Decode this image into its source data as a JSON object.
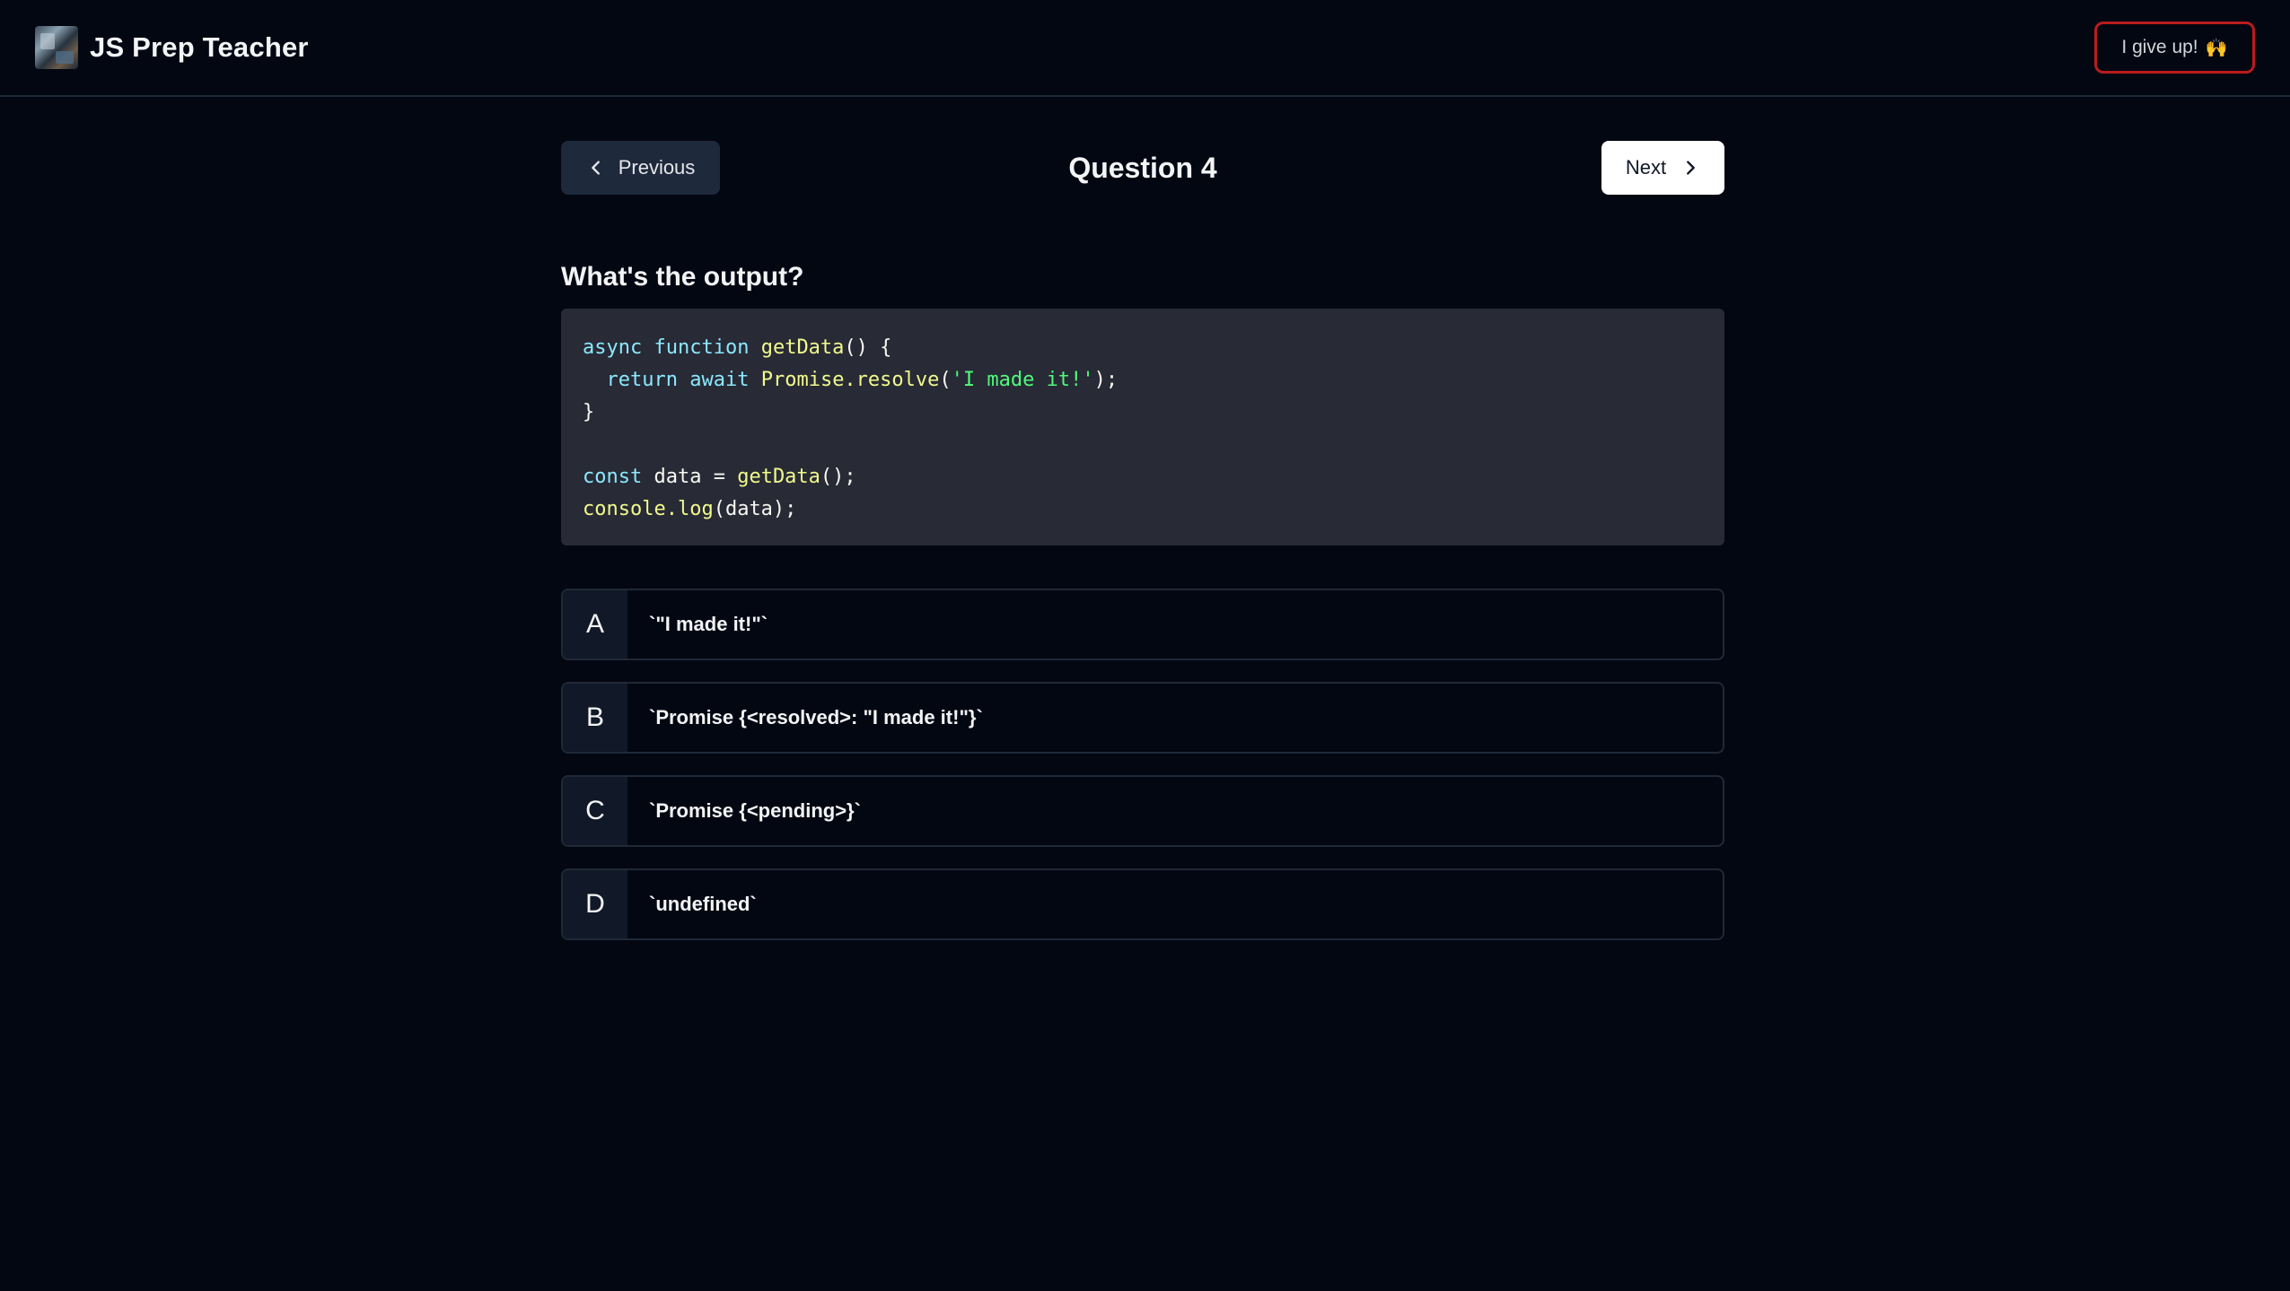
{
  "header": {
    "app_title": "JS Prep Teacher",
    "give_up_label": "I give up!",
    "give_up_emoji": "🙌"
  },
  "navigation": {
    "previous_label": "Previous",
    "next_label": "Next",
    "question_number": "Question 4"
  },
  "question": {
    "prompt": "What's the output?",
    "code": {
      "l1_kw1": "async",
      "l1_kw2": "function",
      "l1_fn": "getData",
      "l1_rest": "() {",
      "l2_kw1": "return",
      "l2_kw2": "await",
      "l2_fn": "Promise.resolve",
      "l2_open": "(",
      "l2_str": "'I made it!'",
      "l2_close": ");",
      "l3": "}",
      "l5_kw": "const",
      "l5_mid": " data = ",
      "l5_fn": "getData",
      "l5_end": "();",
      "l6_fn": "console.log",
      "l6_rest": "(data);"
    }
  },
  "options": [
    {
      "letter": "A",
      "text": "`\"I made it!\"`"
    },
    {
      "letter": "B",
      "text": "`Promise {<resolved>: \"I made it!\"}`"
    },
    {
      "letter": "C",
      "text": "`Promise {<pending>}`"
    },
    {
      "letter": "D",
      "text": "`undefined`"
    }
  ],
  "colors": {
    "background": "#030712",
    "give_up_border": "#b91c1c",
    "code_background": "#282a36"
  }
}
